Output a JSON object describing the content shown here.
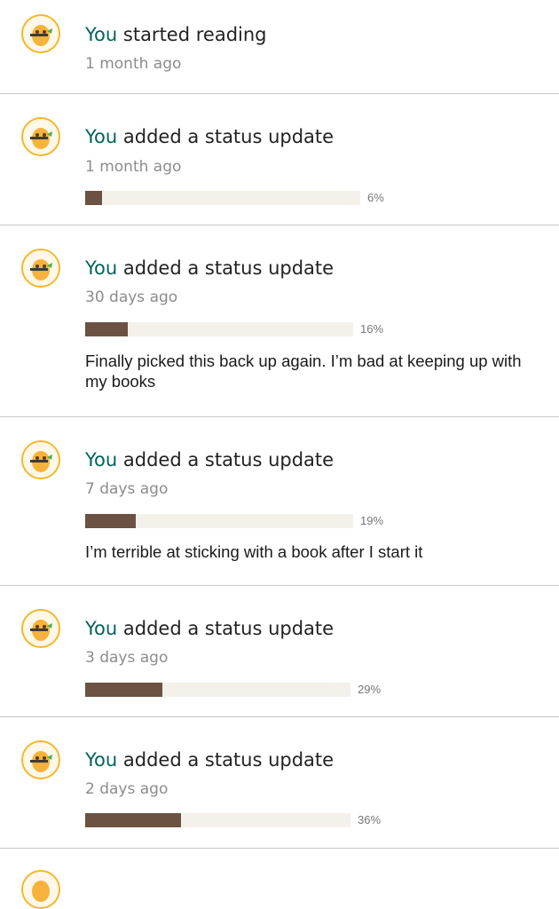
{
  "feed": {
    "items": [
      {
        "actor": "You",
        "action": "started reading",
        "time": "1 month ago"
      },
      {
        "actor": "You",
        "action": "added a status update",
        "time": "1 month ago",
        "progress_label": "6%",
        "progress": 0.06
      },
      {
        "actor": "You",
        "action": "added a status update",
        "time": "30 days ago",
        "progress_label": "16%",
        "progress": 0.16,
        "text": "Finally picked this back up again. I’m bad at keeping up with my books"
      },
      {
        "actor": "You",
        "action": "added a status update",
        "time": "7 days ago",
        "progress_label": "19%",
        "progress": 0.19,
        "text": "I’m terrible at sticking with a book after I start it"
      },
      {
        "actor": "You",
        "action": "added a status update",
        "time": "3 days ago",
        "progress_label": "29%",
        "progress": 0.29
      },
      {
        "actor": "You",
        "action": "added a status update",
        "time": "2 days ago",
        "progress_label": "36%",
        "progress": 0.36
      }
    ]
  },
  "colors": {
    "actor": "#00635d",
    "progress_fill": "#6b5243",
    "progress_track": "#f4f1ea",
    "avatar_ring": "#f2b92c"
  },
  "icons": {
    "avatar": "monster-with-rifle-avatar-icon"
  }
}
